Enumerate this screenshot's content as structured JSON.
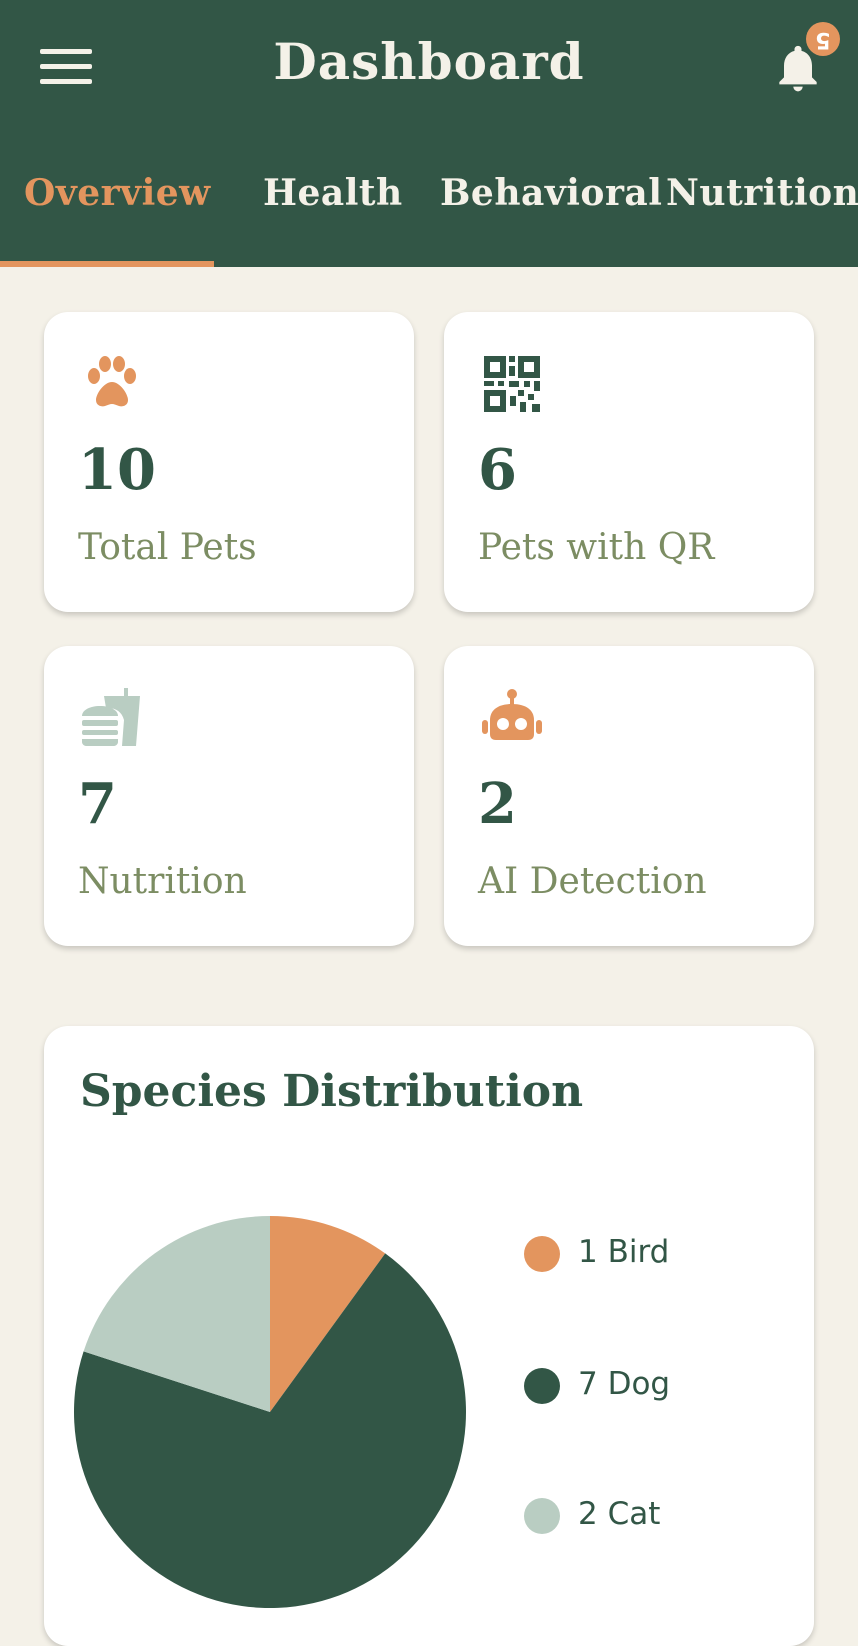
{
  "header": {
    "title": "Dashboard",
    "notification_count": "5"
  },
  "tabs": [
    {
      "label": "Overview",
      "active": true
    },
    {
      "label": "Health",
      "active": false
    },
    {
      "label": "Behavioral",
      "active": false
    },
    {
      "label": "Nutrition",
      "active": false
    }
  ],
  "stats": [
    {
      "value": "10",
      "label": "Total Pets",
      "icon": "paw-icon",
      "icon_color": "#e3955e"
    },
    {
      "value": "6",
      "label": "Pets with QR",
      "icon": "qr-code-icon",
      "icon_color": "#325646"
    },
    {
      "value": "7",
      "label": "Nutrition",
      "icon": "fast-food-icon",
      "icon_color": "#b9cdc2"
    },
    {
      "value": "2",
      "label": "AI Detection",
      "icon": "robot-icon",
      "icon_color": "#e3955e"
    }
  ],
  "species_card": {
    "title": "Species Distribution"
  },
  "chart_data": {
    "type": "pie",
    "title": "Species Distribution",
    "categories": [
      "Bird",
      "Dog",
      "Cat"
    ],
    "values": [
      1,
      7,
      2
    ],
    "legend": [
      "1 Bird",
      "7 Dog",
      "2 Cat"
    ],
    "colors": [
      "#e3955e",
      "#325646",
      "#b9cdc2"
    ],
    "legend_position": "right"
  },
  "colors": {
    "primary": "#325646",
    "accent": "#e3955e",
    "background": "#f4f1e8",
    "muted_label": "#7c8d63",
    "light_green": "#b9cdc2"
  }
}
